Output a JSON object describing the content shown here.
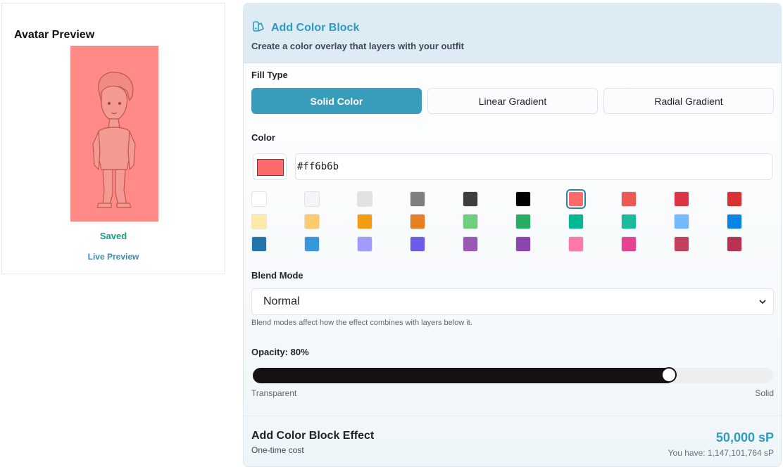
{
  "preview": {
    "title": "Avatar Preview",
    "saved": "Saved",
    "live_link": "Live Preview",
    "overlay_color": "#ff8a86"
  },
  "panel": {
    "title": "Add Color Block",
    "subtitle": "Create a color overlay that layers with your outfit",
    "icon": "color-swatch-icon"
  },
  "fill_type": {
    "label": "Fill Type",
    "options": [
      "Solid Color",
      "Linear Gradient",
      "Radial Gradient"
    ],
    "selected": "Solid Color"
  },
  "color": {
    "label": "Color",
    "value": "#ff6b6b",
    "swatches": [
      "#ffffff",
      "#f4f5f6",
      "#e2e2e2",
      "#7f7f7f",
      "#3f3f3f",
      "#000000",
      "#ff6b6b",
      "#ee5753",
      "#dc3545",
      "#d93232",
      "#ffeaa7",
      "#fdcb6e",
      "#f39c12",
      "#e67e22",
      "#6fcf7e",
      "#27ae60",
      "#00b894",
      "#1abc9c",
      "#74b9ff",
      "#0984e3",
      "#2574a9",
      "#3498db",
      "#a29bfe",
      "#6c5ce7",
      "#9b59b6",
      "#8e44ad",
      "#fd79a8",
      "#e84393",
      "#c2405e",
      "#b83353"
    ],
    "selected_index": 6
  },
  "blend": {
    "label": "Blend Mode",
    "value": "Normal",
    "hint": "Blend modes affect how the effect combines with layers below it."
  },
  "opacity": {
    "label": "Opacity: 80%",
    "value": 0.8,
    "min_label": "Transparent",
    "max_label": "Solid"
  },
  "footer": {
    "title": "Add Color Block Effect",
    "subtitle": "One-time cost",
    "price": "50,000 sP",
    "balance": "You have: 1,147,101,764 sP"
  }
}
